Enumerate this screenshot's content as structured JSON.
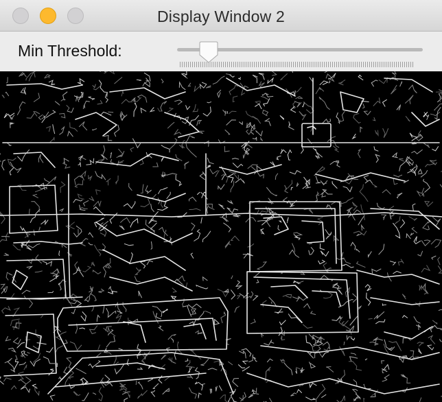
{
  "window": {
    "title": "Display Window 2"
  },
  "controls": {
    "threshold_label": "Min Threshold:",
    "threshold_value_fraction": 0.07
  },
  "image": {
    "description_icon": "edge-detection-output"
  },
  "colors": {
    "close_button": "#d2d1d3",
    "minimize_button": "#fdb92e",
    "zoom_button": "#d2d1d3",
    "image_background": "#000000",
    "edge_color": "#e6e6e6"
  }
}
